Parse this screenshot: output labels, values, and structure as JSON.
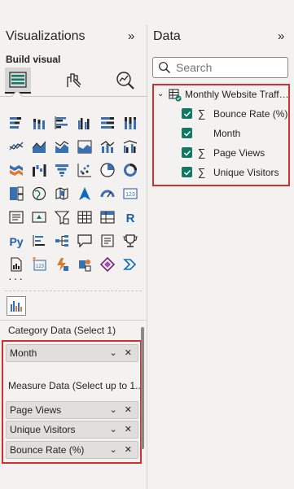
{
  "visualizations": {
    "title": "Visualizations",
    "collapse_label": "»",
    "build_visual_label": "Build visual",
    "more_label": "···",
    "category_well_label": "Category Data (Select 1)",
    "measure_well_label": "Measure Data (Select up to 1...",
    "category_fields": [
      {
        "name": "Month"
      }
    ],
    "measure_fields": [
      {
        "name": "Page Views"
      },
      {
        "name": "Unique Visitors"
      },
      {
        "name": "Bounce Rate (%)"
      }
    ]
  },
  "data": {
    "title": "Data",
    "collapse_label": "»",
    "search_placeholder": "Search",
    "table": {
      "name": "Monthly Website Traffi...",
      "fields": [
        {
          "name": "Bounce Rate (%)",
          "checked": true,
          "sum": true
        },
        {
          "name": "Month",
          "checked": true,
          "sum": false
        },
        {
          "name": "Page Views",
          "checked": true,
          "sum": true
        },
        {
          "name": "Unique Visitors",
          "checked": true,
          "sum": true
        }
      ]
    }
  },
  "colors": {
    "accent_teal": "#117865",
    "highlight_red": "#d32f2f",
    "chart_blue": "#3a6fb0",
    "chart_orange": "#e0782f"
  }
}
